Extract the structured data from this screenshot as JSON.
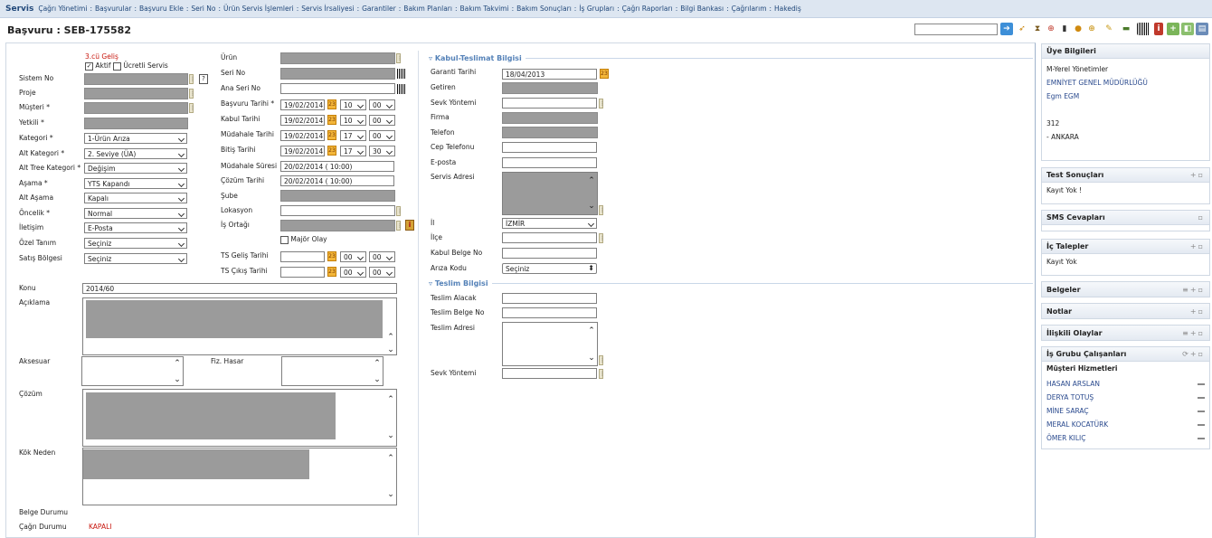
{
  "topnav": {
    "brand": "Servis",
    "items": [
      "Çağrı Yönetimi",
      "Başvurular",
      "Başvuru Ekle",
      "Seri No",
      "Ürün Servis İşlemleri",
      "Servis İrsaliyesi",
      "Garantiler",
      "Bakım Planları",
      "Bakım Takvimi",
      "Bakım Sonuçları",
      "İş Grupları",
      "Çağrı Raporları",
      "Bilgi Bankası",
      "Çağrılarım",
      "Hakediş"
    ]
  },
  "page": {
    "title": "Başvuru : SEB-175582"
  },
  "toolbar": {
    "search_value": "",
    "icons": [
      "go-arrow-icon",
      "rocket-icon",
      "hourglass-icon",
      "lifebuoy-icon",
      "phone-icon",
      "globe-icon",
      "zoom-in-icon",
      "pencil-icon",
      "truck-icon",
      "barcode-icon",
      "info-icon",
      "add-icon",
      "export-icon",
      "print-icon"
    ]
  },
  "left": {
    "visit_count": "3.cü Geliş",
    "aktif_label": "Aktif",
    "aktif_checked": true,
    "ucretli_label": "Ücretli Servis",
    "ucretli_checked": false,
    "labels": {
      "sistem_no": "Sistem No",
      "proje": "Proje",
      "musteri": "Müşteri *",
      "yetkili": "Yetkili *",
      "kategori": "Kategori *",
      "alt_kategori": "Alt Kategori *",
      "alt_tree_kategori": "Alt Tree Kategori *",
      "asama": "Aşama *",
      "alt_asama": "Alt Aşama",
      "oncelik": "Öncelik *",
      "iletisim": "İletişim",
      "ozel_tanim": "Özel Tanım",
      "satis_bolgesi": "Satış Bölgesi",
      "konu": "Konu",
      "aciklama": "Açıklama",
      "aksesuar": "Aksesuar",
      "fiz_hasar": "Fiz. Hasar",
      "cozum": "Çözüm",
      "kok_neden": "Kök Neden",
      "belge_durumu": "Belge Durumu",
      "cagri_durumu": "Çağrı Durumu"
    },
    "values": {
      "kategori": "1-Ürün Arıza",
      "alt_kategori": "2. Seviye (ÜA)",
      "alt_tree_kategori": "Değişim",
      "asama": "YTS Kapandı",
      "alt_asama": "Kapalı",
      "oncelik": "Normal",
      "iletisim": "E-Posta",
      "ozel_tanim": "Seçiniz",
      "satis_bolgesi": "Seçiniz",
      "konu": "2014/60",
      "cagri_durumu": "KAPALI"
    }
  },
  "middle": {
    "labels": {
      "urun": "Ürün",
      "seri_no": "Seri No",
      "ana_seri_no": "Ana Seri No",
      "basvuru_tarihi": "Başvuru Tarihi *",
      "kabul_tarihi": "Kabul Tarihi",
      "mudahale_tarihi": "Müdahale Tarihi",
      "bitis_tarihi": "Bitiş Tarihi",
      "mudahale_suresi": "Müdahale Süresi",
      "cozum_tarihi": "Çözüm Tarihi",
      "sube": "Şube",
      "lokasyon": "Lokasyon",
      "is_ortagi": "İş Ortağı",
      "major_olay": "Majör Olay",
      "ts_gelis": "TS Geliş Tarihi",
      "ts_cikis": "TS Çıkış Tarihi"
    },
    "dates": {
      "basvuru": {
        "date": "19/02/2014",
        "hour": "10",
        "min": "00"
      },
      "kabul": {
        "date": "19/02/2014",
        "hour": "10",
        "min": "00"
      },
      "mudahale": {
        "date": "19/02/2014",
        "hour": "17",
        "min": "00"
      },
      "bitis": {
        "date": "19/02/2014",
        "hour": "17",
        "min": "30"
      },
      "ts_gelis": {
        "date": "",
        "hour": "00",
        "min": "00"
      },
      "ts_cikis": {
        "date": "",
        "hour": "00",
        "min": "00"
      }
    },
    "mudahale_suresi": "20/02/2014 ( 10:00)",
    "cozum_tarihi": "20/02/2014 ( 10:00)"
  },
  "kabul": {
    "section_title": "Kabul-Teslimat Bilgisi",
    "labels": {
      "garanti_tarihi": "Garanti Tarihi",
      "getiren": "Getiren",
      "sevk_yontemi": "Sevk Yöntemi",
      "firma": "Firma",
      "telefon": "Telefon",
      "cep_telefonu": "Cep Telefonu",
      "eposta": "E-posta",
      "servis_adresi": "Servis Adresi",
      "il": "İl",
      "ilce": "İlçe",
      "kabul_belge_no": "Kabul Belge No",
      "ariza_kodu": "Arıza Kodu"
    },
    "garanti_tarihi": "18/04/2013",
    "il": "İZMİR",
    "ariza_kodu": "Seçiniz"
  },
  "teslim": {
    "section_title": "Teslim Bilgisi",
    "labels": {
      "teslim_alacak": "Teslim Alacak",
      "teslim_belge_no": "Teslim Belge No",
      "teslim_adresi": "Teslim Adresi",
      "sevk_yontemi": "Sevk Yöntemi"
    }
  },
  "right": {
    "uye": {
      "title": "Üye Bilgileri",
      "line1": "M-Yerel Yönetimler",
      "line2": "EMNİYET GENEL MÜDÜRLÜĞÜ",
      "line3": "Egm EGM",
      "line4": "312",
      "line5": "- ANKARA"
    },
    "test": {
      "title": "Test Sonuçları",
      "body": "Kayıt Yok !"
    },
    "sms": {
      "title": "SMS Cevapları"
    },
    "ic_talepler": {
      "title": "İç Talepler",
      "body": "Kayıt Yok"
    },
    "belgeler": {
      "title": "Belgeler"
    },
    "notlar": {
      "title": "Notlar"
    },
    "iliskili": {
      "title": "İlişkili Olaylar"
    },
    "isgrubu": {
      "title": "İş Grubu Çalışanları",
      "subtitle": "Müşteri Hizmetleri",
      "members": [
        "HASAN ARSLAN",
        "DERYA TOTUŞ",
        "MİNE SARAÇ",
        "MERAL KOCATÜRK",
        "ÖMER KILIÇ"
      ]
    }
  }
}
